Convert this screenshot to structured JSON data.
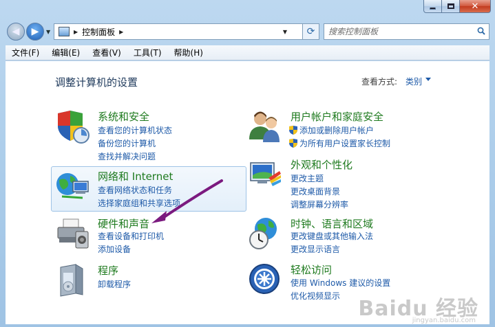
{
  "nav": {
    "address_crumb": "控制面板",
    "search_placeholder": "搜索控制面板"
  },
  "menu": [
    "文件(F)",
    "编辑(E)",
    "查看(V)",
    "工具(T)",
    "帮助(H)"
  ],
  "page": {
    "title": "调整计算机的设置",
    "view_by_label": "查看方式:",
    "view_by_value": "类别"
  },
  "categories": [
    {
      "title": "系统和安全",
      "links": [
        "查看您的计算机状态",
        "备份您的计算机",
        "查找并解决问题"
      ],
      "icon": "security-shield-icon"
    },
    {
      "title": "用户帐户和家庭安全",
      "links": [
        "添加或删除用户帐户",
        "为所有用户设置家长控制"
      ],
      "icon": "users-icon"
    },
    {
      "title": "网络和 Internet",
      "links": [
        "查看网络状态和任务",
        "选择家庭组和共享选项"
      ],
      "icon": "network-globe-icon"
    },
    {
      "title": "外观和个性化",
      "links": [
        "更改主题",
        "更改桌面背景",
        "调整屏幕分辨率"
      ],
      "icon": "appearance-monitor-icon"
    },
    {
      "title": "硬件和声音",
      "links": [
        "查看设备和打印机",
        "添加设备"
      ],
      "icon": "printer-icon"
    },
    {
      "title": "时钟、语言和区域",
      "links": [
        "更改键盘或其他输入法",
        "更改显示语言"
      ],
      "icon": "clock-globe-icon"
    },
    {
      "title": "程序",
      "links": [
        "卸载程序"
      ],
      "icon": "programs-icon"
    },
    {
      "title": "轻松访问",
      "links": [
        "使用 Windows 建议的设置",
        "优化视频显示"
      ],
      "icon": "ease-of-access-icon"
    }
  ],
  "watermark": {
    "main": "Baidu 经验",
    "sub": "jingyan.baidu.com"
  },
  "colors": {
    "category_title": "#1e7a1e",
    "link": "#1e5aa8",
    "annotation_arrow": "#7b1a7f"
  }
}
